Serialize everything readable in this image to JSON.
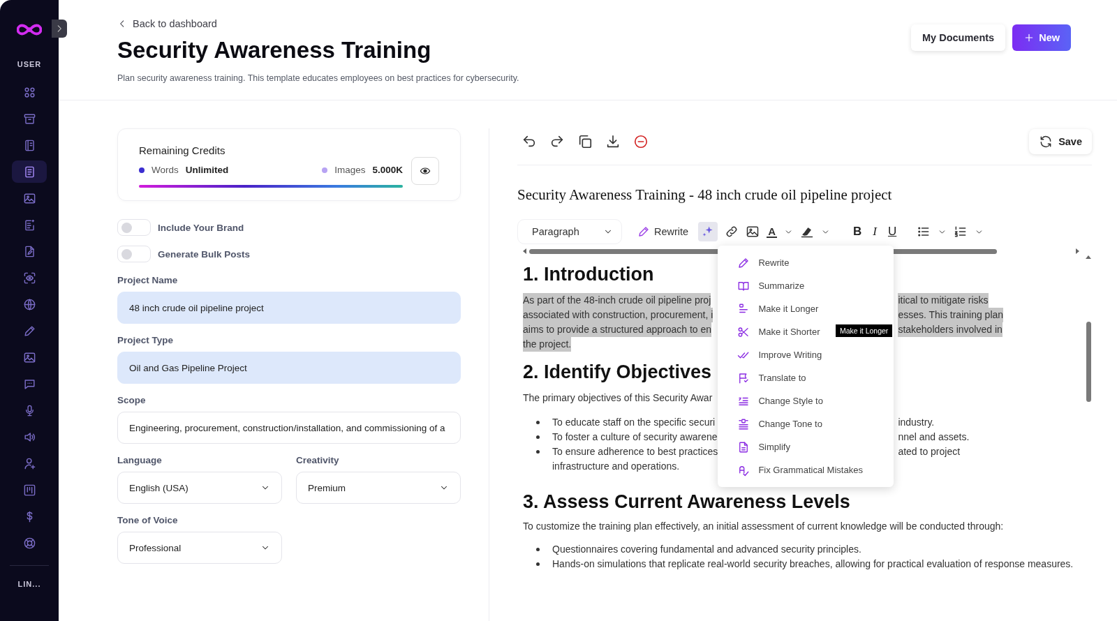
{
  "sidebar": {
    "section_label": "USER",
    "items": [
      {
        "selected": false
      },
      {
        "selected": false
      },
      {
        "selected": false
      },
      {
        "selected": true
      },
      {
        "selected": false
      },
      {
        "selected": false
      },
      {
        "selected": false
      },
      {
        "selected": false
      },
      {
        "selected": false
      },
      {
        "selected": false
      },
      {
        "selected": false
      },
      {
        "selected": false
      },
      {
        "selected": false
      },
      {
        "selected": false
      },
      {
        "selected": false
      },
      {
        "selected": false
      },
      {
        "selected": false
      },
      {
        "selected": false
      }
    ],
    "footer_label": "LIN..."
  },
  "header": {
    "back_link": "Back to dashboard",
    "title": "Security Awareness Training",
    "description": "Plan security awareness training. This template educates employees on best practices for cybersecurity.",
    "buttons": [
      {
        "kind": "secondary",
        "label": "My Documents"
      },
      {
        "kind": "primary",
        "label": "New"
      }
    ]
  },
  "credits": {
    "title": "Remaining Credits",
    "level": 1,
    "items": [
      {
        "label": "Words",
        "value": "Unlimited",
        "color": "#3b2ed0"
      },
      {
        "label": "Images",
        "value": "5.000K",
        "color": "#b7a3f3"
      }
    ]
  },
  "toggles": [
    {
      "label": "Include Your Brand",
      "on": false
    },
    {
      "label": "Generate Bulk Posts",
      "on": false
    }
  ],
  "fields": [
    {
      "kind": "input",
      "label": "Project Name",
      "value": "48 inch crude oil pipeline project",
      "autofilled": true
    },
    {
      "kind": "input",
      "label": "Project Type",
      "value": "Oil and Gas Pipeline Project",
      "autofilled": true
    },
    {
      "kind": "input",
      "label": "Scope",
      "value": "Engineering, procurement, construction/installation, and commissioning of a",
      "autofilled": false
    },
    {
      "kind": "select",
      "label": "Language",
      "value": "English (USA)"
    },
    {
      "kind": "select",
      "label": "Creativity",
      "value": "Premium"
    },
    {
      "kind": "select",
      "label": "Tone of Voice",
      "value": "Professional"
    }
  ],
  "editor": {
    "save_label": "Save",
    "title": "Security Awareness Training - 48 inch crude oil pipeline project",
    "format": {
      "block_style": "Paragraph",
      "rewrite_label": "Rewrite",
      "ai_active": true,
      "text_color_glyph": "A",
      "marks": [
        "B",
        "I",
        "U"
      ]
    },
    "ai_menu": {
      "items": [
        "Rewrite",
        "Summarize",
        "Make it Longer",
        "Make it Shorter",
        "Improve Writing",
        "Translate to",
        "Change Style to",
        "Change Tone to",
        "Simplify",
        "Fix Grammatical Mistakes"
      ],
      "tooltip": "Make it Longer"
    },
    "beside_menu": [
      {
        "kind": "heading",
        "text": "1. Introduction"
      },
      {
        "kind": "paragraph",
        "highlighted": true,
        "lines": [
          {
            "left": "As part of the 48-inch crude oil pipeline proj",
            "right": "itical to mitigate risks"
          },
          {
            "left": "associated with construction, procurement, i",
            "right": "esses. This training plan"
          },
          {
            "left": "aims to provide a structured approach to en",
            "right": "stakeholders involved in"
          },
          {
            "left": "the project."
          }
        ]
      },
      {
        "kind": "heading",
        "text": "2. Identify Objectives"
      },
      {
        "kind": "paragraph",
        "highlighted": false,
        "lines": [
          {
            "left": "The primary objectives of this Security Awar"
          }
        ]
      },
      {
        "kind": "bullets",
        "items": [
          {
            "lines": [
              {
                "left": "To educate staff on the specific securi",
                "right": "industry."
              }
            ]
          },
          {
            "lines": [
              {
                "left": "To foster a culture of security awarene",
                "right": "nnel and assets."
              }
            ]
          },
          {
            "lines": [
              {
                "left": "To ensure adherence to best practices",
                "right": "ated to project"
              },
              {
                "left": "infrastructure and operations."
              }
            ]
          }
        ]
      }
    ],
    "below_menu": [
      {
        "kind": "heading",
        "text": "3. Assess Current Awareness Levels"
      },
      {
        "kind": "paragraph",
        "text": "To customize the training plan effectively, an initial assessment of current knowledge will be conducted through:"
      },
      {
        "kind": "bullets",
        "items": [
          {
            "text": "Questionnaires covering fundamental and advanced security principles."
          },
          {
            "text": "Hands-on simulations that replicate real-world security breaches, allowing for practical evaluation of response measures."
          }
        ]
      }
    ]
  }
}
